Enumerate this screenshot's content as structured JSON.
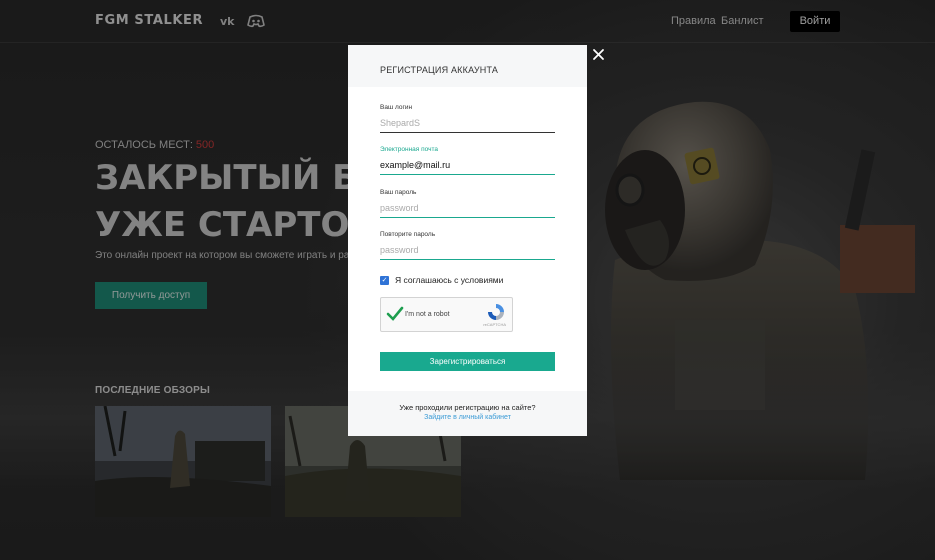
{
  "header": {
    "logo": "FGM STALKER",
    "nav": [
      "Правила",
      "Банлист"
    ],
    "login_label": "Войти"
  },
  "hero": {
    "seats_label": "ОСТАЛОСЬ МЕСТ:",
    "seats_value": "500",
    "title_line1": "ЗАКРЫТЫЙ БЕТА",
    "title_line2": "УЖЕ СТАРТОВАЛ",
    "description": "Это онлайн проект на котором вы сможете играть и разви",
    "access_button": "Получить доступ"
  },
  "reviews": {
    "title": "ПОСЛЕДНИЕ ОБЗОРЫ"
  },
  "modal": {
    "title": "РЕГИСТРАЦИЯ АККАУНТА",
    "login": {
      "label": "Ваш логин",
      "placeholder": "ShepardS"
    },
    "email": {
      "label": "Электронная почта",
      "value": "example@mail.ru"
    },
    "password": {
      "label": "Ваш пароль",
      "placeholder": "password"
    },
    "password_repeat": {
      "label": "Повторите пароль",
      "placeholder": "password"
    },
    "agree_label": "Я соглашаюсь с условиями",
    "captcha_label": "I'm not a robot",
    "captcha_brand": "reCAPTCHA",
    "submit_label": "Зарегистрироваться",
    "footer_question": "Уже проходили регистрацию на сайте?",
    "footer_link": "Зайдите в личный кабинет"
  },
  "colors": {
    "accent": "#19a98f",
    "seats_count": "#d23c3c",
    "link": "#3b9bd6",
    "checkbox": "#2f73d6"
  },
  "icons": [
    "vk-icon",
    "discord-icon",
    "close-icon",
    "checkmark-icon",
    "recaptcha-icon"
  ]
}
